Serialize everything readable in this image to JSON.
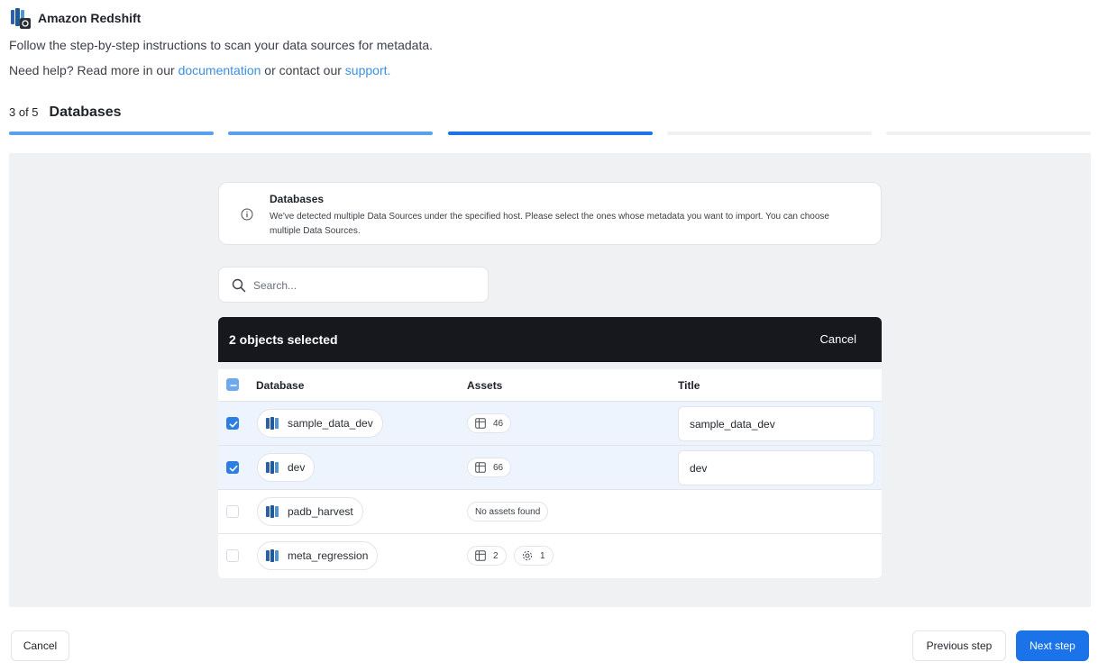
{
  "app": {
    "title": "Amazon Redshift",
    "intro": "Follow the step-by-step instructions to scan your data sources for metadata.",
    "help_prefix": "Need help? Read more in our ",
    "help_link_docs": "documentation",
    "help_middle": " or contact our ",
    "help_link_support": "support."
  },
  "step": {
    "counter": "3 of 5",
    "title": "Databases",
    "current": 3,
    "total": 5
  },
  "info": {
    "title": "Databases",
    "text": "We've detected multiple Data Sources under the specified host. Please select the ones whose metadata you want to import. You can choose multiple Data Sources."
  },
  "search": {
    "placeholder": "Search...",
    "value": ""
  },
  "selection": {
    "text": "2 objects selected",
    "cancel_label": "Cancel"
  },
  "table": {
    "columns": [
      "Database",
      "Assets",
      "Title"
    ],
    "rows": [
      {
        "name": "sample_data_dev",
        "checked": true,
        "tables": "46",
        "title": "sample_data_dev"
      },
      {
        "name": "dev",
        "checked": true,
        "tables": "66",
        "title": "dev"
      },
      {
        "name": "padb_harvest",
        "checked": false,
        "no_assets": "No assets found"
      },
      {
        "name": "meta_regression",
        "checked": false,
        "tables": "2",
        "procs": "1"
      }
    ]
  },
  "footer": {
    "cancel_label": "Cancel",
    "prev_label": "Previous step",
    "next_label": "Next step"
  },
  "colors": {
    "accent": "#1a73e8",
    "link": "#3b8fe0",
    "selection_bar": "#16181d",
    "selected_row": "#eef4fd",
    "panel_bg": "#f0f1f3"
  },
  "icons": [
    "redshift-logo-icon",
    "info-icon",
    "search-icon",
    "database-icon",
    "table-icon",
    "gear-icon",
    "checkbox-check-icon"
  ]
}
